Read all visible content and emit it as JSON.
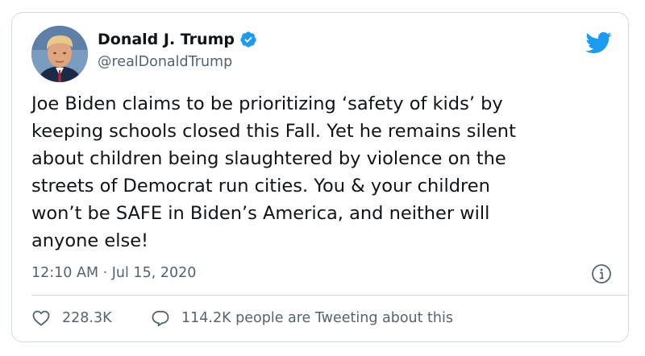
{
  "user": {
    "display_name": "Donald J. Trump",
    "handle": "@realDonaldTrump",
    "verified": true
  },
  "tweet": {
    "text": "Joe Biden claims to be prioritizing ‘safety of kids’ by\nkeeping schools closed this Fall. Yet he remains silent\nabout children being slaughtered by violence on the\nstreets of Democrat run cities. You & your children\nwon’t be SAFE in Biden’s America, and neither will\nanyone else!",
    "timestamp": "12:10 AM · Jul 15, 2020"
  },
  "actions": {
    "likes": "228.3K",
    "tweeting": "114.2K people are Tweeting about this"
  },
  "icons": {
    "brand": "twitter-bird-icon",
    "verified": "verified-badge-icon",
    "info": "info-icon",
    "like": "heart-icon",
    "reply": "speech-bubble-icon"
  },
  "colors": {
    "twitter_blue": "#1d9bf0",
    "text": "#0f1419",
    "muted": "#536471",
    "border": "#cfd9de"
  }
}
